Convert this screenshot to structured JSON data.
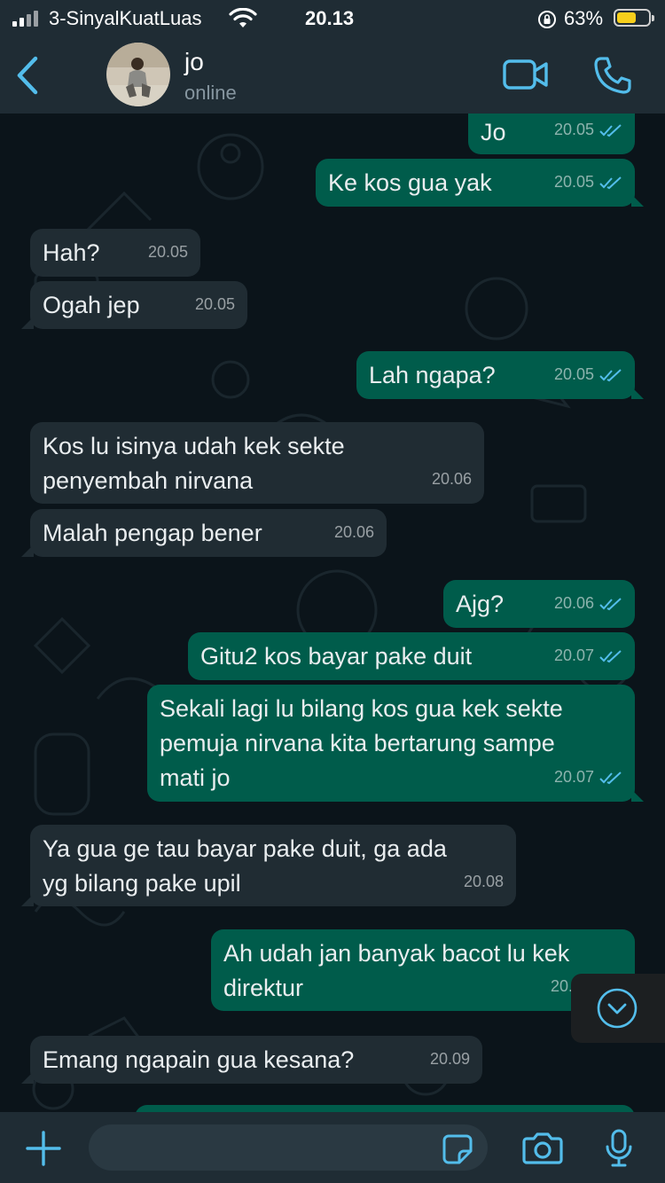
{
  "status_bar": {
    "carrier": "3-SinyalKuatLuas",
    "time": "20.13",
    "battery_percent": "63%",
    "battery_level": 0.63,
    "icons": [
      "signal-icon",
      "wifi-icon",
      "orientation-lock-icon",
      "battery-icon"
    ]
  },
  "header": {
    "contact_name": "jo",
    "status": "online",
    "icons": [
      "back-icon",
      "video-call-icon",
      "voice-call-icon"
    ]
  },
  "messages": [
    {
      "dir": "out",
      "text": "Jo",
      "time": "20.05",
      "read": true
    },
    {
      "dir": "out",
      "text": "Ke kos gua yak",
      "time": "20.05",
      "read": true
    },
    {
      "dir": "in",
      "text": "Hah?",
      "time": "20.05"
    },
    {
      "dir": "in",
      "text": "Ogah jep",
      "time": "20.05"
    },
    {
      "dir": "out",
      "text": "Lah ngapa?",
      "time": "20.05",
      "read": true
    },
    {
      "dir": "in",
      "text": "Kos lu isinya udah kek sekte\npenyembah nirvana",
      "time": "20.06"
    },
    {
      "dir": "in",
      "text": "Malah pengap bener",
      "time": "20.06"
    },
    {
      "dir": "out",
      "text": "Ajg?",
      "time": "20.06",
      "read": true
    },
    {
      "dir": "out",
      "text": "Gitu2 kos bayar pake duit",
      "time": "20.07",
      "read": true
    },
    {
      "dir": "out",
      "text": "Sekali lagi lu bilang kos gua kek sekte\npemuja nirvana kita bertarung sampe\nmati jo",
      "time": "20.07",
      "read": true
    },
    {
      "dir": "in",
      "text": "Ya gua ge tau bayar pake duit, ga ada\nyg bilang pake upil",
      "time": "20.08"
    },
    {
      "dir": "out",
      "text": "Ah udah jan banyak bacot lu kek\ndirektur",
      "time": "20.",
      "read": false
    },
    {
      "dir": "in",
      "text": "Emang ngapain gua kesana?",
      "time": "20.09"
    }
  ],
  "input": {
    "placeholder": "",
    "icons": [
      "plus-icon",
      "sticker-icon",
      "camera-icon",
      "mic-icon"
    ]
  },
  "colors": {
    "incoming_bubble": "#202c33",
    "outgoing_bubble": "#005c4b",
    "accent": "#53bdeb",
    "background": "#0b141a"
  }
}
